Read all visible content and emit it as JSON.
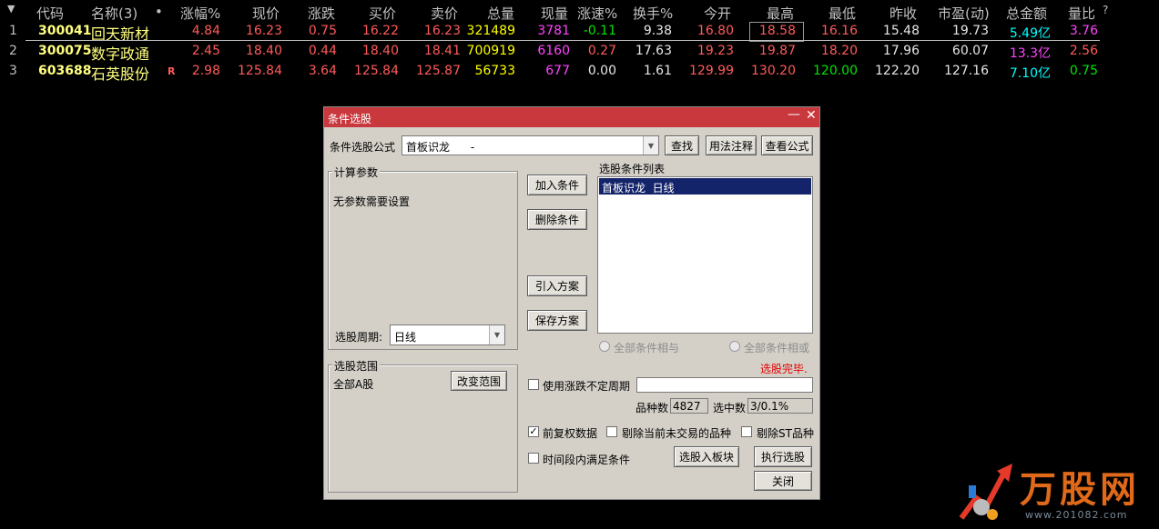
{
  "table": {
    "headers": [
      "代码",
      "名称(3)",
      "•",
      "涨幅%",
      "现价",
      "涨跌",
      "买价",
      "卖价",
      "总量",
      "现量",
      "涨速%",
      "换手%",
      "今开",
      "最高",
      "最低",
      "昨收",
      "市盈(动)",
      "总金额",
      "量比",
      "?"
    ],
    "rows": [
      {
        "idx": "1",
        "code": "300041",
        "name": "回天新材",
        "flag": "",
        "pct": "4.84",
        "price": "16.23",
        "chg": "0.75",
        "bid": "16.22",
        "ask": "16.23",
        "vol": "321489",
        "cur": "3781",
        "speed": "-0.11",
        "turn": "9.38",
        "open": "16.80",
        "high": "18.58",
        "low": "16.16",
        "prev": "15.48",
        "pe": "19.73",
        "amt": "5.49",
        "amt_unit": "亿",
        "ratio": "3.76"
      },
      {
        "idx": "2",
        "code": "300075",
        "name": "数字政通",
        "flag": "",
        "pct": "2.45",
        "price": "18.40",
        "chg": "0.44",
        "bid": "18.40",
        "ask": "18.41",
        "vol": "700919",
        "cur": "6160",
        "speed": "0.27",
        "turn": "17.63",
        "open": "19.23",
        "high": "19.87",
        "low": "18.20",
        "prev": "17.96",
        "pe": "60.07",
        "amt": "13.3",
        "amt_unit": "亿",
        "ratio": "2.56"
      },
      {
        "idx": "3",
        "code": "603688",
        "name": "石英股份",
        "flag": "R",
        "pct": "2.98",
        "price": "125.84",
        "chg": "3.64",
        "bid": "125.84",
        "ask": "125.87",
        "vol": "56733",
        "cur": "677",
        "speed": "0.00",
        "turn": "1.61",
        "open": "129.99",
        "high": "130.20",
        "low": "120.00",
        "prev": "122.20",
        "pe": "127.16",
        "amt": "7.10",
        "amt_unit": "亿",
        "ratio": "0.75"
      }
    ]
  },
  "dialog": {
    "title": "条件选股",
    "formula_label": "条件选股公式",
    "formula_value": "首板识龙      -",
    "btn_find": "查找",
    "btn_usage": "用法注释",
    "btn_view": "查看公式",
    "calc_group": "计算参数",
    "calc_text": "无参数需要设置",
    "period_label": "选股周期:",
    "period_value": "日线",
    "btn_add": "加入条件",
    "btn_delete": "删除条件",
    "btn_import": "引入方案",
    "btn_save": "保存方案",
    "list_label": "选股条件列表",
    "list_items": [
      "首板识龙  日线"
    ],
    "radio_and": "全部条件相与",
    "radio_or": "全部条件相或",
    "status": "选股完毕.",
    "range_group": "选股范围",
    "range_value": "全部A股",
    "btn_range": "改变范围",
    "chk_unfixed": "使用涨跌不定周期",
    "count_label": "品种数",
    "count_value": "4827",
    "selected_label": "选中数",
    "selected_value": "3/0.1%",
    "chk_rights": "前复权数据",
    "chk_rights_checked": true,
    "chk_exclude_untraded": "剔除当前未交易的品种",
    "chk_exclude_st": "剔除ST品种",
    "chk_timespan": "时间段内满足条件",
    "btn_to_block": "选股入板块",
    "btn_execute": "执行选股",
    "btn_close": "关闭"
  },
  "watermark": {
    "logo_text": "万股网",
    "url": "www.201082.com"
  },
  "colors": {
    "titlebar": "#c8383d",
    "up": "#ff5a5a",
    "down": "#00e600",
    "code": "#ffff80",
    "bg": "#000000"
  }
}
